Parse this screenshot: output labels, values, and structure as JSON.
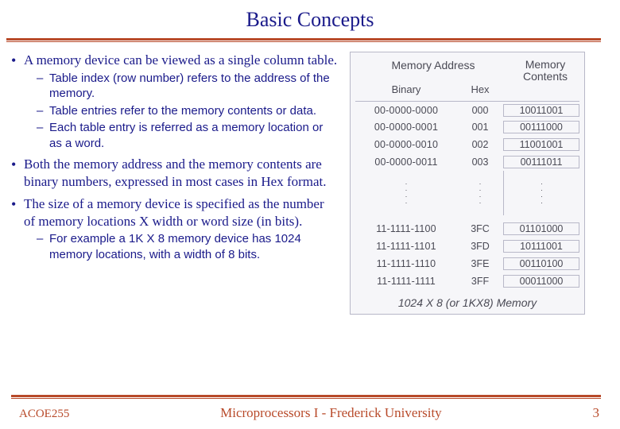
{
  "title": "Basic Concepts",
  "bullets": [
    {
      "text": "A memory device can be viewed as a single column table.",
      "subs": [
        "Table index (row number) refers to the address of the memory.",
        "Table entries refer to the memory contents or data.",
        "Each table entry is referred as a memory location or as a word."
      ]
    },
    {
      "text": "Both the memory address and the memory contents are binary numbers, expressed in most cases in Hex format.",
      "subs": []
    },
    {
      "text": "The size of a memory device is specified as the number of memory locations X width or word size (in bits).",
      "subs": [
        "For example a 1K X 8 memory device has 1024 memory locations, with a width of 8 bits."
      ]
    }
  ],
  "figure": {
    "header_addr": "Memory Address",
    "header_cont": "Memory Contents",
    "sub_bin": "Binary",
    "sub_hex": "Hex",
    "rows_top": [
      {
        "bin": "00-0000-0000",
        "hex": "000",
        "cont": "10011001"
      },
      {
        "bin": "00-0000-0001",
        "hex": "001",
        "cont": "00111000"
      },
      {
        "bin": "00-0000-0010",
        "hex": "002",
        "cont": "11001001"
      },
      {
        "bin": "00-0000-0011",
        "hex": "003",
        "cont": "00111011"
      }
    ],
    "rows_bot": [
      {
        "bin": "11-1111-1100",
        "hex": "3FC",
        "cont": "01101000"
      },
      {
        "bin": "11-1111-1101",
        "hex": "3FD",
        "cont": "10111001"
      },
      {
        "bin": "11-1111-1110",
        "hex": "3FE",
        "cont": "00110100"
      },
      {
        "bin": "11-1111-1111",
        "hex": "3FF",
        "cont": "00011000"
      }
    ],
    "caption": "1024 X 8 (or 1KX8) Memory"
  },
  "footer": {
    "course": "ACOE255",
    "center": "Microprocessors I - Frederick University",
    "page": "3"
  }
}
